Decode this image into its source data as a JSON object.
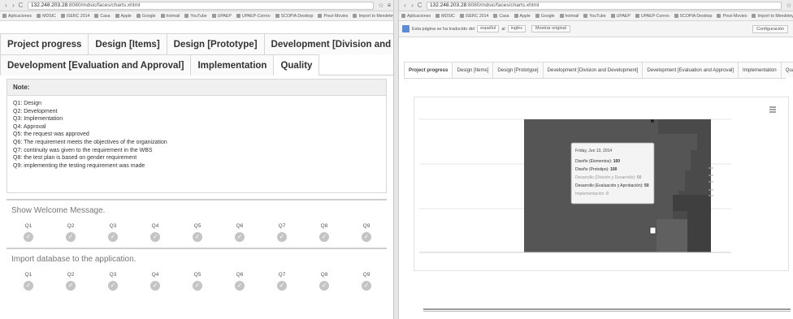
{
  "left": {
    "url_host": "132.248.203.28",
    "url_path": ":8080/mdsic/faces/charts.xhtml",
    "bookmarks": [
      "Aplicaciones",
      "MDSIC",
      "iSERC 2014",
      "Casa",
      "Apple",
      "Google",
      "hotmail",
      "YouTube",
      "UPAEP",
      "UPAEP-Correo",
      "SCOPIA Desktop",
      "Prezi-Movies",
      "Import to Mendeley"
    ],
    "tabs_row1": [
      "Project progress",
      "Design [Items]",
      "Design [Prototype]",
      "Development [Division and Development]"
    ],
    "tabs_row2": [
      "Development [Evaluation and Approval]",
      "Implementation",
      "Quality"
    ],
    "active_tab": "Quality",
    "note": {
      "title": "Note:",
      "lines": [
        "Q1: Design",
        "Q2: Development",
        "Q3: Implementation",
        "Q4: Approval",
        "Q5: the request was approved",
        "Q6: The requirement meets the objectives of the organization",
        "Q7: continuity was given to the requirement in the WBS",
        "Q8: the test plan is based on gender requirement",
        "Q9: implementing the testing requirement was made"
      ]
    },
    "sections": [
      {
        "title": "Show Welcome Message.",
        "labels": [
          "Q1",
          "Q2",
          "Q3",
          "Q4",
          "Q5",
          "Q6",
          "Q7",
          "Q8",
          "Q9"
        ]
      },
      {
        "title": "Import database to the application.",
        "labels": [
          "Q1",
          "Q2",
          "Q3",
          "Q4",
          "Q5",
          "Q6",
          "Q7",
          "Q8",
          "Q9"
        ]
      }
    ]
  },
  "right": {
    "url_host": "132.248.203.28",
    "url_path": ":8080/mdsic/faces/charts.xhtml",
    "bookmarks": [
      "Aplicaciones",
      "MDSIC",
      "iSERC 2014",
      "Casa",
      "Apple",
      "Google",
      "hotmail",
      "YouTube",
      "UPAEP",
      "UPAEP-Correo",
      "SCOPIA Desktop",
      "Prezi-Movies",
      "Import to Mendeley"
    ],
    "translate": {
      "prefix": "Esta página se ha traducido del",
      "from": "español",
      "to_label": "al",
      "to": "inglés",
      "show_original": "Mostrar original",
      "config": "Configuración"
    },
    "tabs": [
      "Project progress",
      "Design [Items]",
      "Design [Prototype]",
      "Development [Division and Development]",
      "Development [Evaluation and Approval]",
      "Implementation",
      "Quality"
    ],
    "active_tab": "Project progress",
    "tooltip": {
      "date": "Friday, Jun 13, 2014",
      "rows": [
        {
          "label": "Diseño (Elementos)",
          "value": "100"
        },
        {
          "label": "Diseño (Prototipo)",
          "value": "100"
        },
        {
          "label": "Desarrollo (División y Desarrollo)",
          "value": "50"
        },
        {
          "label": "Desarrollo (Evaluación y Aprobación)",
          "value": "50"
        },
        {
          "label": "Implementación",
          "value": "0"
        }
      ]
    },
    "menu_icon": "hamburger-menu-icon"
  },
  "colors": {
    "chart_dark": "#545454",
    "chart_mid": "#6a6a6a",
    "chart_light": "#7d7d7d",
    "check_gray": "#c4c4c4"
  }
}
